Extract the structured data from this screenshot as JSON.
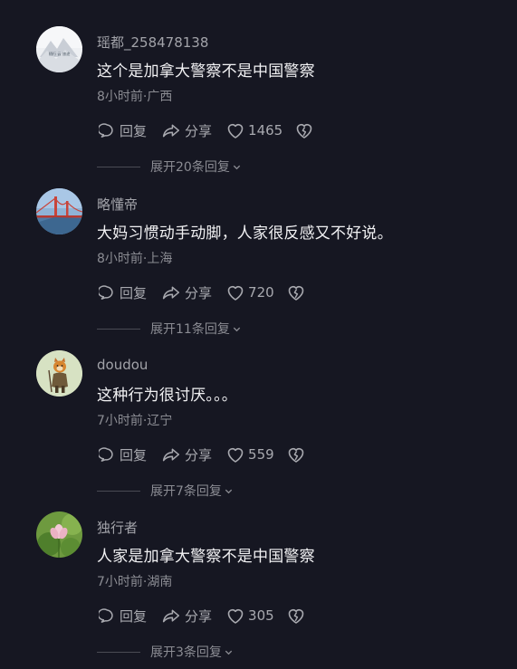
{
  "actions": {
    "reply_label": "回复",
    "share_label": "分享"
  },
  "colors": {
    "background": "#161722",
    "text_primary": "#f1f1f3",
    "text_secondary": "#8b8c93"
  },
  "comments": [
    {
      "username": "瑶都_258478138",
      "content": "这个是加拿大警察不是中国警察",
      "meta": "8小时前·广西",
      "likes": "1465",
      "expand": "展开20条回复",
      "avatar": "mountain-landscape-avatar",
      "avatar_caption": "随行 云 旅途"
    },
    {
      "username": "略懂帝",
      "content": "大妈习惯动手动脚，人家很反感又不好说。",
      "meta": "8小时前·上海",
      "likes": "720",
      "expand": "展开11条回复",
      "avatar": "golden-gate-bridge-avatar"
    },
    {
      "username": "doudou",
      "content": "这种行为很讨厌。。。",
      "meta": "7小时前·辽宁",
      "likes": "559",
      "expand": "展开7条回复",
      "avatar": "tiger-warrior-avatar"
    },
    {
      "username": "独行者",
      "content": "人家是加拿大警察不是中国警察",
      "meta": "7小时前·湖南",
      "likes": "305",
      "expand": "展开3条回复",
      "avatar": "lotus-flower-avatar"
    }
  ]
}
